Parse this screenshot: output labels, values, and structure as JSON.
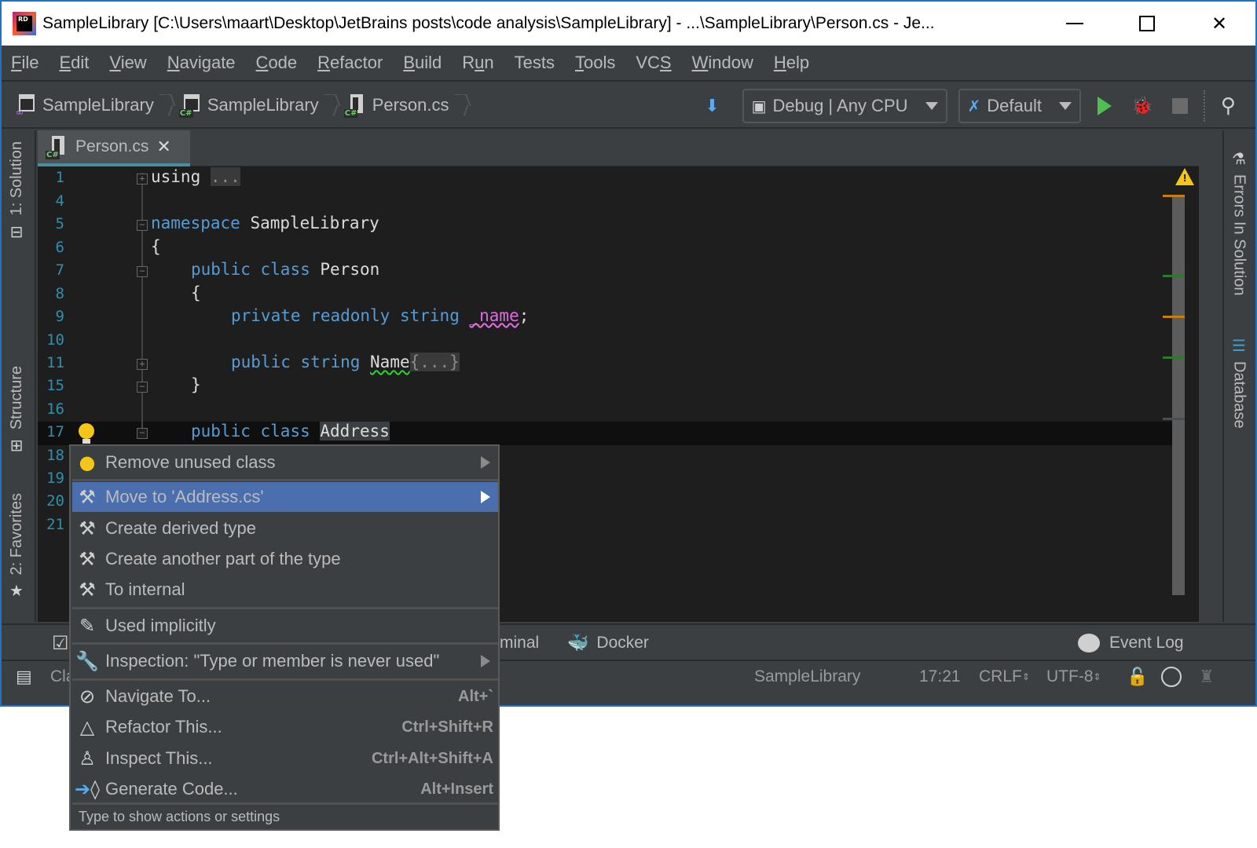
{
  "window": {
    "title": "SampleLibrary [C:\\Users\\maart\\Desktop\\JetBrains posts\\code analysis\\SampleLibrary] - ...\\SampleLibrary\\Person.cs - Je...",
    "app_icon_label": "RD"
  },
  "menubar": {
    "items": [
      {
        "label": "File",
        "mnemonic": "F"
      },
      {
        "label": "Edit",
        "mnemonic": "E"
      },
      {
        "label": "View",
        "mnemonic": "V"
      },
      {
        "label": "Navigate",
        "mnemonic": "N"
      },
      {
        "label": "Code",
        "mnemonic": "C"
      },
      {
        "label": "Refactor",
        "mnemonic": "R"
      },
      {
        "label": "Build",
        "mnemonic": "B"
      },
      {
        "label": "Run",
        "mnemonic": "u"
      },
      {
        "label": "Tests",
        "mnemonic": ""
      },
      {
        "label": "Tools",
        "mnemonic": "T"
      },
      {
        "label": "VCS",
        "mnemonic": "S"
      },
      {
        "label": "Window",
        "mnemonic": "W"
      },
      {
        "label": "Help",
        "mnemonic": "H"
      }
    ]
  },
  "breadcrumbs": [
    {
      "label": "SampleLibrary",
      "icon": "solution-icon"
    },
    {
      "label": "SampleLibrary",
      "icon": "csharp-project-icon"
    },
    {
      "label": "Person.cs",
      "icon": "csharp-file-icon"
    }
  ],
  "toolbar": {
    "config_label": "Debug | Any CPU",
    "run_config_label": "Default"
  },
  "left_tools": {
    "solution": "1: Solution",
    "structure": "Structure",
    "favorites": "2: Favorites"
  },
  "right_tools": {
    "errors": "Errors In Solution",
    "database": "Database"
  },
  "editor_tab": {
    "label": "Person.cs",
    "close_glyph": "✕"
  },
  "code": {
    "lines": [
      {
        "num": "1"
      },
      {
        "num": "4"
      },
      {
        "num": "5"
      },
      {
        "num": "6"
      },
      {
        "num": "7"
      },
      {
        "num": "8"
      },
      {
        "num": "9"
      },
      {
        "num": "10"
      },
      {
        "num": "11"
      },
      {
        "num": "15"
      },
      {
        "num": "16"
      },
      {
        "num": "17"
      },
      {
        "num": "18"
      },
      {
        "num": "19"
      },
      {
        "num": "20"
      },
      {
        "num": "21"
      }
    ],
    "using_kw": "using",
    "using_fold": "...",
    "namespace_kw": "namespace",
    "namespace_name": "SampleLibrary",
    "open_brace": "{",
    "close_brace": "}",
    "public_kw": "public",
    "class_kw": "class",
    "private_kw": "private",
    "readonly_kw": "readonly",
    "string_kw": "string",
    "class_person": "Person",
    "field_name": "_name",
    "semicolon": ";",
    "prop_name": "Name",
    "prop_fold": "{...}",
    "class_address": "Address"
  },
  "bottom_tools": {
    "terminal": "minal",
    "docker": "Docker",
    "event_log": "Event Log"
  },
  "statusbar": {
    "left_text": "Cla",
    "solution": "SampleLibrary",
    "position": "17:21",
    "line_endings": "CRLF",
    "encoding": "UTF-8"
  },
  "popup": {
    "items": [
      {
        "label": "Remove unused class",
        "icon": "bulb",
        "submenu": true
      },
      {
        "label": "Move to 'Address.cs'",
        "icon": "hammer",
        "submenu": true,
        "selected": true
      },
      {
        "label": "Create derived type",
        "icon": "hammer"
      },
      {
        "label": "Create another part of the type",
        "icon": "hammer"
      },
      {
        "label": "To internal",
        "icon": "hammer"
      },
      {
        "label": "Used implicitly",
        "icon": "pencil"
      },
      {
        "label": "Inspection: \"Type or member is never used\"",
        "icon": "wrench",
        "submenu": true
      },
      {
        "label": "Navigate To...",
        "icon": "compass",
        "shortcut": "Alt+`"
      },
      {
        "label": "Refactor This...",
        "icon": "prism",
        "shortcut": "Ctrl+Shift+R"
      },
      {
        "label": "Inspect This...",
        "icon": "inspector",
        "shortcut": "Ctrl+Alt+Shift+A"
      },
      {
        "label": "Generate Code...",
        "icon": "generate",
        "shortcut": "Alt+Insert"
      }
    ],
    "footer": "Type to show actions or settings"
  },
  "colors": {
    "selection": "#4b6eaf",
    "keyword": "#569cd6",
    "line_number": "#2b91af",
    "accent_border": "#1e73c8"
  }
}
